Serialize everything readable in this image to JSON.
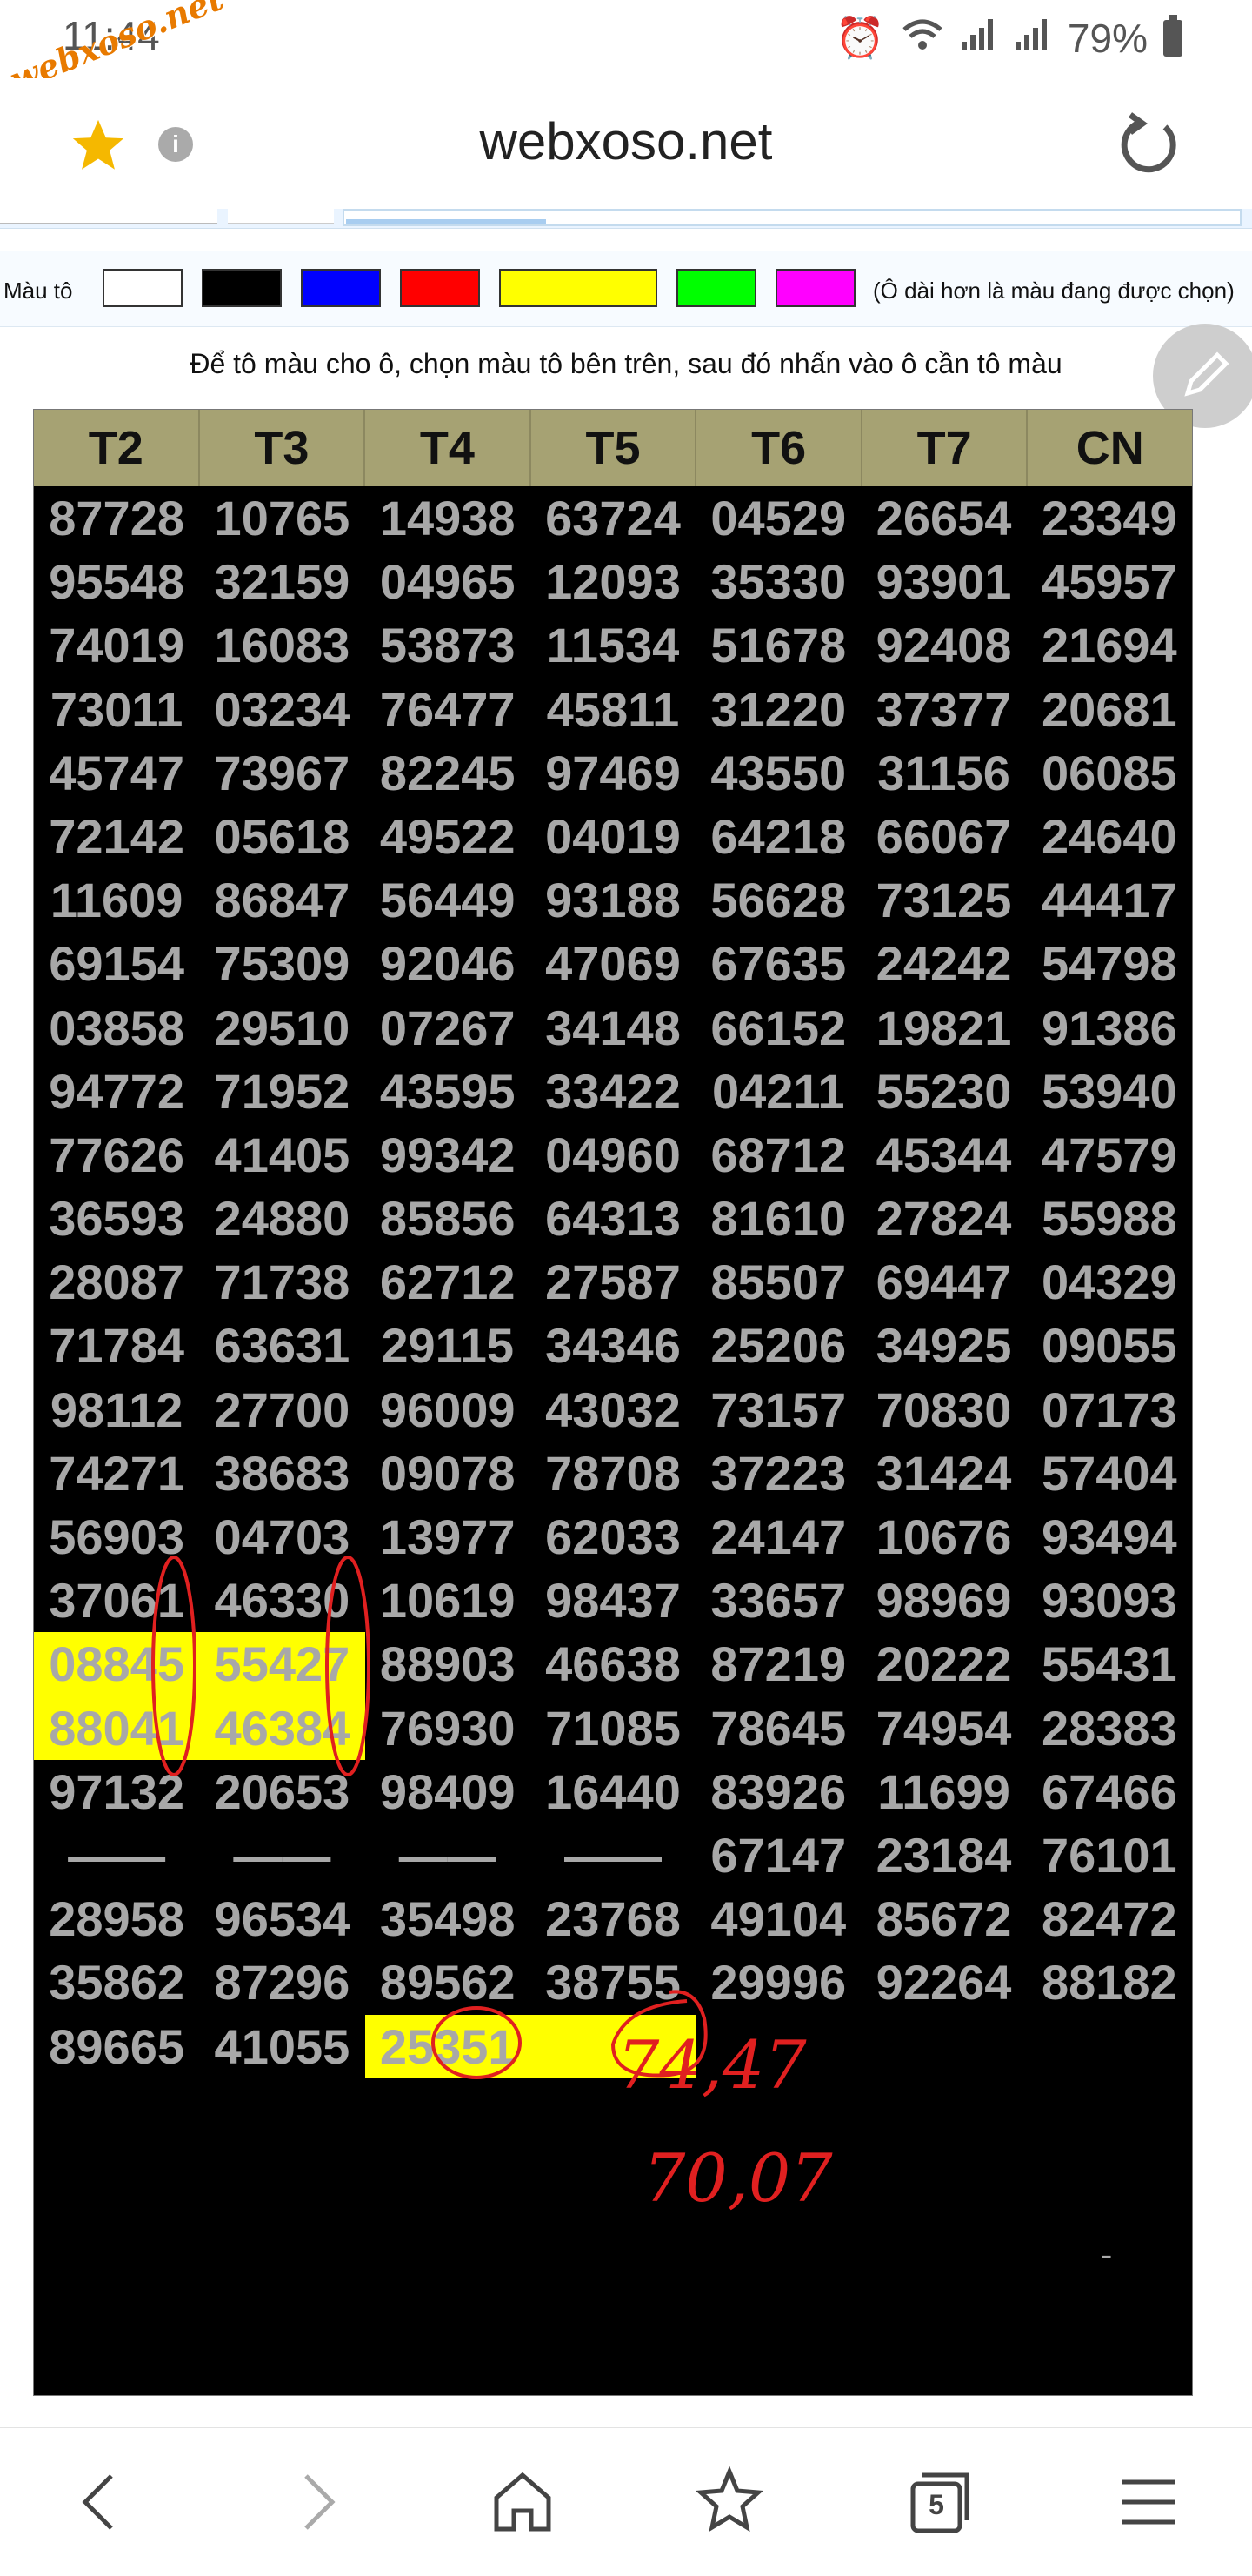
{
  "status": {
    "time": "11:44",
    "battery": "79%",
    "watermark": "webxoso.net"
  },
  "browser": {
    "url": "webxoso.net",
    "tab_count": "5"
  },
  "palette": {
    "label": "Màu tô",
    "colors": [
      "#ffffff",
      "#000000",
      "#0000ff",
      "#ff0000",
      "#ffff00",
      "#00ff00",
      "#ff00ff"
    ],
    "note": "(Ô dài hơn là màu đang được chọn)"
  },
  "instruction": "Để tô màu cho ô, chọn màu tô bên trên, sau đó nhấn vào ô cần tô màu",
  "table": {
    "headers": [
      "T2",
      "T3",
      "T4",
      "T5",
      "T6",
      "T7",
      "CN"
    ],
    "rows": [
      [
        "87728",
        "10765",
        "14938",
        "63724",
        "04529",
        "26654",
        "23349"
      ],
      [
        "95548",
        "32159",
        "04965",
        "12093",
        "35330",
        "93901",
        "45957"
      ],
      [
        "74019",
        "16083",
        "53873",
        "11534",
        "51678",
        "92408",
        "21694"
      ],
      [
        "73011",
        "03234",
        "76477",
        "45811",
        "31220",
        "37377",
        "20681"
      ],
      [
        "45747",
        "73967",
        "82245",
        "97469",
        "43550",
        "31156",
        "06085"
      ],
      [
        "72142",
        "05618",
        "49522",
        "04019",
        "64218",
        "66067",
        "24640"
      ],
      [
        "11609",
        "86847",
        "56449",
        "93188",
        "56628",
        "73125",
        "44417"
      ],
      [
        "69154",
        "75309",
        "92046",
        "47069",
        "67635",
        "24242",
        "54798"
      ],
      [
        "03858",
        "29510",
        "07267",
        "34148",
        "66152",
        "19821",
        "91386"
      ],
      [
        "94772",
        "71952",
        "43595",
        "33422",
        "04211",
        "55230",
        "53940"
      ],
      [
        "77626",
        "41405",
        "99342",
        "04960",
        "68712",
        "45344",
        "47579"
      ],
      [
        "36593",
        "24880",
        "85856",
        "64313",
        "81610",
        "27824",
        "55988"
      ],
      [
        "28087",
        "71738",
        "62712",
        "27587",
        "85507",
        "69447",
        "04329"
      ],
      [
        "71784",
        "63631",
        "29115",
        "34346",
        "25206",
        "34925",
        "09055"
      ],
      [
        "98112",
        "27700",
        "96009",
        "43032",
        "73157",
        "70830",
        "07173"
      ],
      [
        "74271",
        "38683",
        "09078",
        "78708",
        "37223",
        "31424",
        "57404"
      ],
      [
        "56903",
        "04703",
        "13977",
        "62033",
        "24147",
        "10676",
        "93494"
      ],
      [
        "37061",
        "46330",
        "10619",
        "98437",
        "33657",
        "98969",
        "93093"
      ],
      [
        "08845",
        "55427",
        "88903",
        "46638",
        "87219",
        "20222",
        "55431"
      ],
      [
        "88041",
        "46384",
        "76930",
        "71085",
        "78645",
        "74954",
        "28383"
      ],
      [
        "97132",
        "20653",
        "98409",
        "16440",
        "83926",
        "11699",
        "67466"
      ],
      [
        "——",
        "——",
        "——",
        "——",
        "67147",
        "23184",
        "76101"
      ],
      [
        "28958",
        "96534",
        "35498",
        "23768",
        "49104",
        "85672",
        "82472"
      ],
      [
        "35862",
        "87296",
        "89562",
        "38755",
        "29996",
        "92264",
        "88182"
      ],
      [
        "89665",
        "41055",
        "25351",
        "",
        "",
        "",
        ""
      ]
    ],
    "highlighted": [
      "18-0",
      "18-1",
      "19-0",
      "19-1",
      "24-2",
      "24-3"
    ],
    "footer_mark": "-"
  },
  "annotations": {
    "note1": "74,47",
    "note2": "70,07"
  }
}
